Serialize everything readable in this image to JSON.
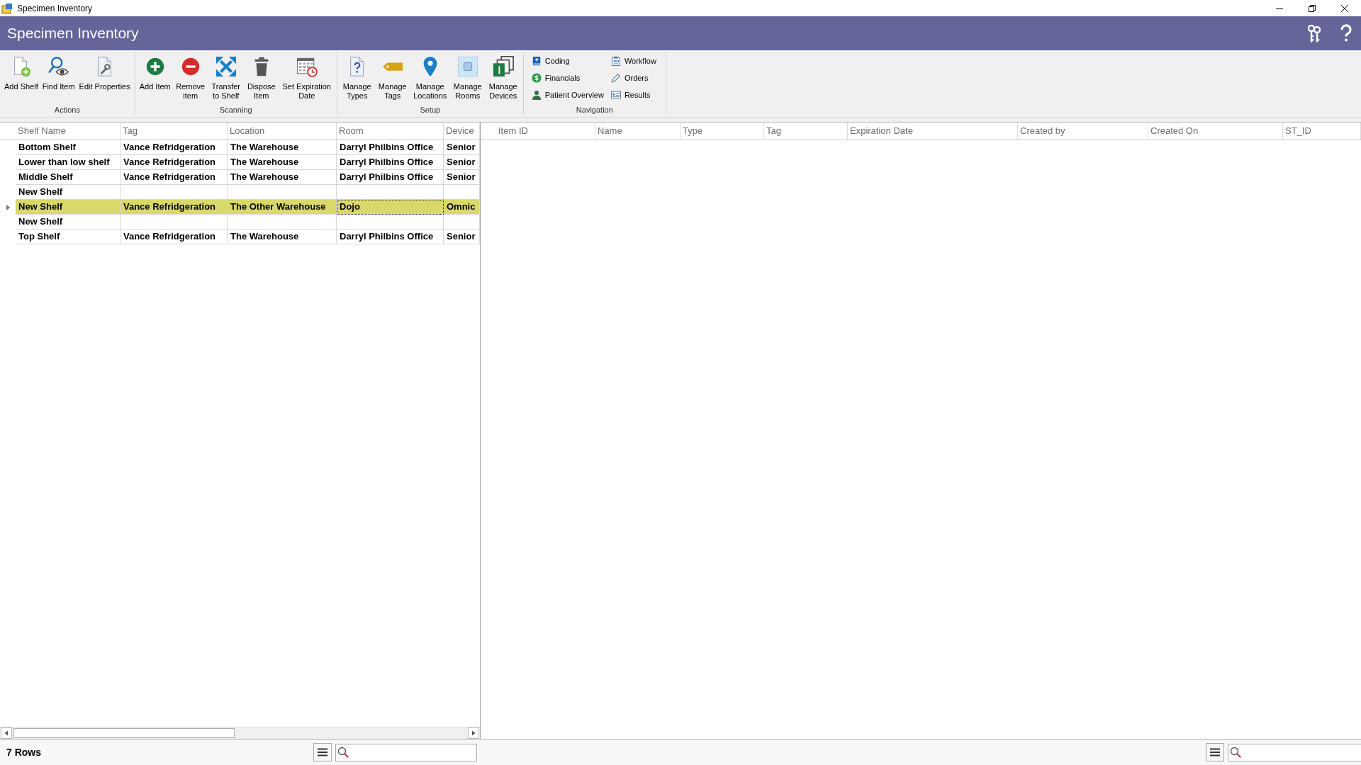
{
  "window": {
    "title": "Specimen Inventory"
  },
  "header": {
    "title": "Specimen Inventory"
  },
  "ribbon": {
    "groups": [
      {
        "label": "Actions",
        "kind": "large",
        "items": [
          {
            "label": "Add Shelf",
            "kind": "addshelf"
          },
          {
            "label": "Find Item",
            "kind": "find"
          },
          {
            "label": "Edit Properties",
            "kind": "edit"
          }
        ]
      },
      {
        "label": "Scanning",
        "kind": "large",
        "items": [
          {
            "label": "Add Item",
            "kind": "additem"
          },
          {
            "label": "Remove item",
            "kind": "remove"
          },
          {
            "label": "Transfer to Shelf",
            "kind": "transfer"
          },
          {
            "label": "Dispose Item",
            "kind": "dispose"
          },
          {
            "label": "Set Expiration Date",
            "kind": "expiry"
          }
        ]
      },
      {
        "label": "Setup",
        "kind": "large",
        "items": [
          {
            "label": "Manage Types",
            "kind": "types"
          },
          {
            "label": "Manage Tags",
            "kind": "tags"
          },
          {
            "label": "Manage Locations",
            "kind": "locations"
          },
          {
            "label": "Manage Rooms",
            "kind": "rooms"
          },
          {
            "label": "Manage Devices",
            "kind": "devices"
          }
        ]
      },
      {
        "label": "Navigation",
        "kind": "small",
        "items": [
          {
            "label": "Coding",
            "kind": "coding"
          },
          {
            "label": "Financials",
            "kind": "financials"
          },
          {
            "label": "Patient Overview",
            "kind": "patient"
          },
          {
            "label": "Workflow",
            "kind": "workflow"
          },
          {
            "label": "Orders",
            "kind": "orders"
          },
          {
            "label": "Results",
            "kind": "results"
          }
        ]
      }
    ]
  },
  "left_grid": {
    "columns": [
      "Shelf Name",
      "Tag",
      "Location",
      "Room",
      "Device"
    ],
    "rows": [
      {
        "selected": false,
        "cells": [
          {
            "text": "Bottom Shelf",
            "focused": false
          },
          {
            "text": "Vance Refridgeration",
            "focused": false
          },
          {
            "text": "The Warehouse",
            "focused": false
          },
          {
            "text": "Darryl Philbins Office",
            "focused": false
          },
          {
            "text": "Senior",
            "focused": false
          }
        ]
      },
      {
        "selected": false,
        "cells": [
          {
            "text": "Lower than low shelf",
            "focused": false
          },
          {
            "text": "Vance Refridgeration",
            "focused": false
          },
          {
            "text": "The Warehouse",
            "focused": false
          },
          {
            "text": "Darryl Philbins Office",
            "focused": false
          },
          {
            "text": "Senior",
            "focused": false
          }
        ]
      },
      {
        "selected": false,
        "cells": [
          {
            "text": "Middle Shelf",
            "focused": false
          },
          {
            "text": "Vance Refridgeration",
            "focused": false
          },
          {
            "text": "The Warehouse",
            "focused": false
          },
          {
            "text": "Darryl Philbins Office",
            "focused": false
          },
          {
            "text": "Senior",
            "focused": false
          }
        ]
      },
      {
        "selected": false,
        "cells": [
          {
            "text": "New Shelf",
            "focused": false
          },
          {
            "focused": false
          },
          {
            "focused": false
          },
          {
            "focused": false
          },
          {
            "focused": false
          }
        ]
      },
      {
        "selected": true,
        "cells": [
          {
            "text": "New Shelf",
            "focused": false
          },
          {
            "text": "Vance Refridgeration",
            "focused": false
          },
          {
            "text": "The Other Warehouse",
            "focused": false
          },
          {
            "text": "Dojo",
            "focused": true
          },
          {
            "text": "Omnic",
            "focused": false
          }
        ]
      },
      {
        "selected": false,
        "cells": [
          {
            "text": "New Shelf",
            "focused": false
          },
          {
            "focused": false
          },
          {
            "focused": false
          },
          {
            "focused": false
          },
          {
            "focused": false
          }
        ]
      },
      {
        "selected": false,
        "cells": [
          {
            "text": "Top Shelf",
            "focused": false
          },
          {
            "text": "Vance Refridgeration",
            "focused": false
          },
          {
            "text": "The Warehouse",
            "focused": false
          },
          {
            "text": "Darryl Philbins Office",
            "focused": false
          },
          {
            "text": "Senior",
            "focused": false
          }
        ]
      }
    ]
  },
  "right_grid": {
    "columns": [
      "Item ID",
      "Name",
      "Type",
      "Tag",
      "Expiration Date",
      "Created by",
      "Created On",
      "ST_ID"
    ]
  },
  "status_bar": {
    "row_count": "7 Rows"
  }
}
